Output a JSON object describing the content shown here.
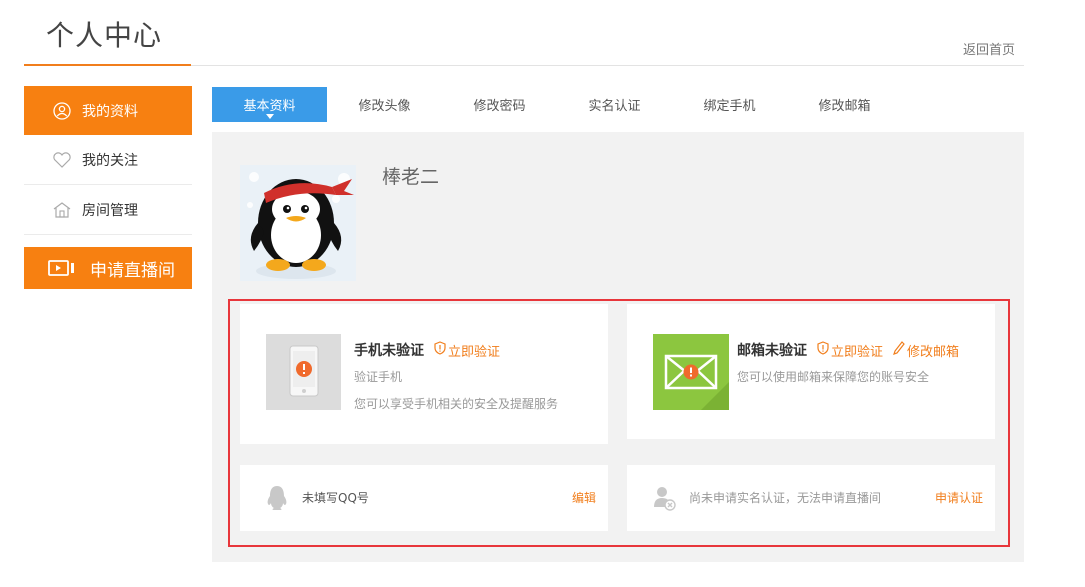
{
  "header": {
    "title": "个人中心",
    "back_link": "返回首页"
  },
  "sidebar": {
    "items": [
      {
        "label": "我的资料",
        "icon": "user-icon",
        "active": true
      },
      {
        "label": "我的关注",
        "icon": "heart-icon",
        "active": false
      },
      {
        "label": "房间管理",
        "icon": "home-icon",
        "active": false
      }
    ],
    "apply_button": "申请直播间"
  },
  "tabs": [
    {
      "label": "基本资料",
      "active": true
    },
    {
      "label": "修改头像"
    },
    {
      "label": "修改密码"
    },
    {
      "label": "实名认证"
    },
    {
      "label": "绑定手机"
    },
    {
      "label": "修改邮箱"
    }
  ],
  "profile": {
    "username": "棒老二"
  },
  "cards": {
    "phone": {
      "title": "手机未验证",
      "action": "立即验证",
      "sub1": "验证手机",
      "sub2": "您可以享受手机相关的安全及提醒服务"
    },
    "email": {
      "title": "邮箱未验证",
      "action1": "立即验证",
      "action2": "修改邮箱",
      "sub1": "您可以使用邮箱来保障您的账号安全"
    },
    "qq": {
      "text": "未填写QQ号",
      "action": "编辑"
    },
    "real_name": {
      "text": "尚未申请实名认证，无法申请直播间",
      "action": "申请认证"
    }
  },
  "colors": {
    "accent_orange": "#f78011",
    "tab_blue": "#3a9be8",
    "email_green": "#8cc63f",
    "highlight_red": "#e8363b"
  }
}
